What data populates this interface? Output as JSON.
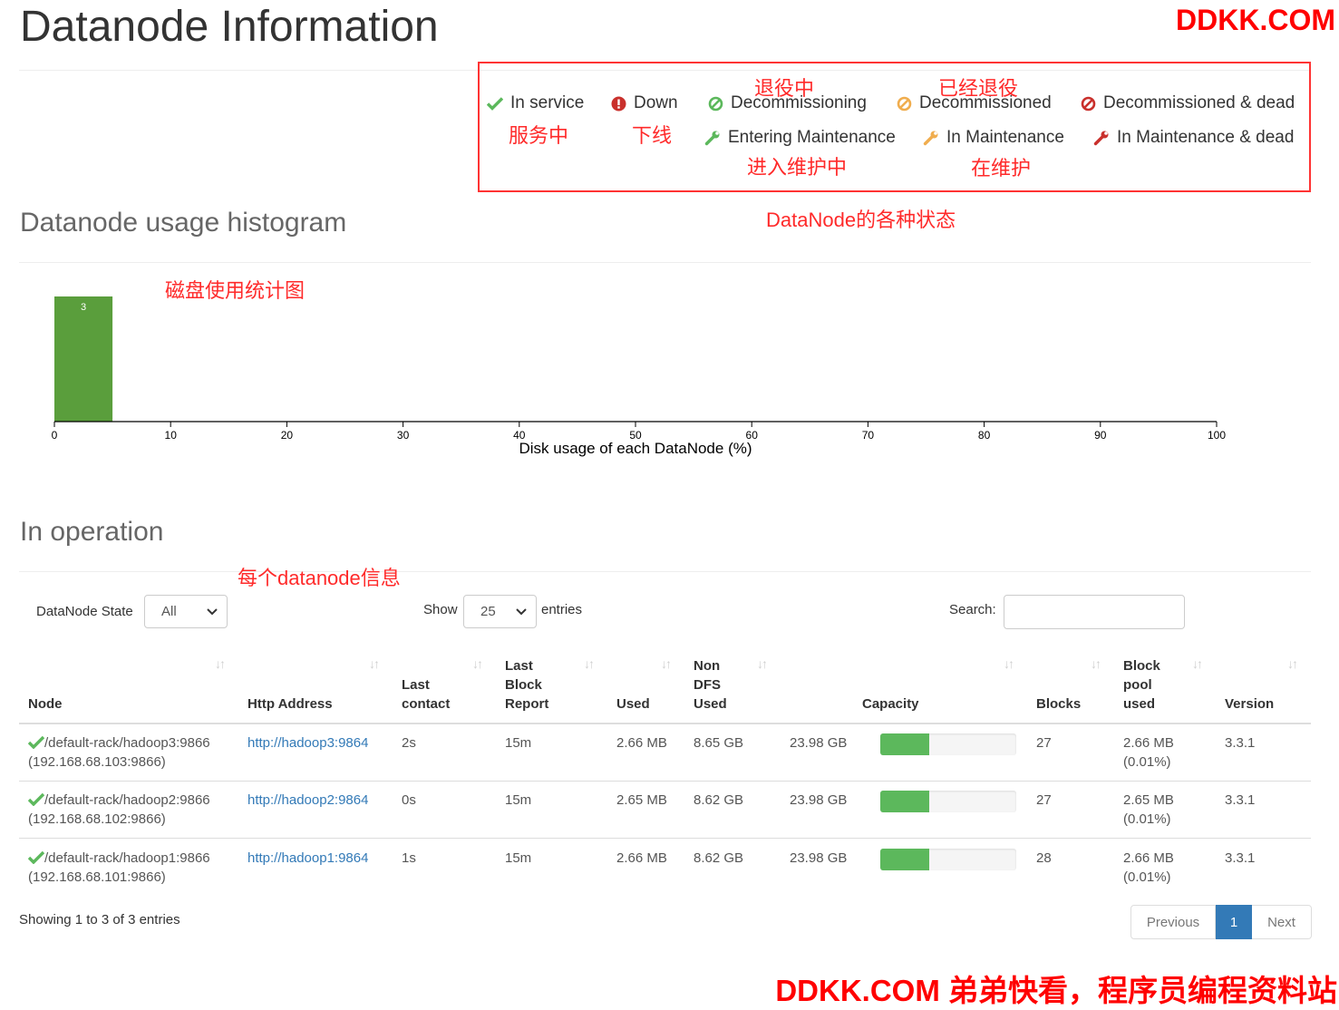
{
  "page": {
    "title": "Datanode Information",
    "watermark_top": "DDKK.COM",
    "watermark_bottom": "DDKK.COM 弟弟快看，程序员编程资料站"
  },
  "legend": {
    "items": [
      {
        "label": "In service",
        "icon": "check-icon",
        "color": "#5cb85c"
      },
      {
        "label": "Down",
        "icon": "exclamation-circle-icon",
        "color": "#d9534f"
      },
      {
        "label": "Decommissioning",
        "icon": "ban-icon",
        "color": "#5cb85c"
      },
      {
        "label": "Decommissioned",
        "icon": "ban-icon",
        "color": "#f0ad4e"
      },
      {
        "label": "Decommissioned & dead",
        "icon": "ban-icon",
        "color": "#d9534f"
      },
      {
        "label": "Entering Maintenance",
        "icon": "wrench-icon",
        "color": "#5cb85c"
      },
      {
        "label": "In Maintenance",
        "icon": "wrench-icon",
        "color": "#f0ad4e"
      },
      {
        "label": "In Maintenance & dead",
        "icon": "wrench-icon",
        "color": "#d9534f"
      }
    ]
  },
  "annotations": {
    "in_service": "服务中",
    "down": "下线",
    "decommissioning": "退役中",
    "decommissioned": "已经退役",
    "entering_maintenance": "进入维护中",
    "in_maintenance": "在维护",
    "states": "DataNode的各种状态",
    "histogram": "磁盘使用统计图",
    "datanode_info": "每个datanode信息"
  },
  "histogram": {
    "title": "Datanode usage histogram"
  },
  "chart_data": {
    "type": "bar",
    "x": [
      0,
      5
    ],
    "values": [
      3
    ],
    "data_labels": [
      "3"
    ],
    "xlabel": "Disk usage of each DataNode (%)",
    "xlim": [
      0,
      100
    ],
    "xticks": [
      "0",
      "10",
      "20",
      "30",
      "40",
      "50",
      "60",
      "70",
      "80",
      "90",
      "100"
    ],
    "bar_color": "#5a9e3c"
  },
  "operation": {
    "title": "In operation",
    "state_label": "DataNode State",
    "state_value": "All",
    "show_label": "Show",
    "entries_value": "25",
    "entries_label": "entries",
    "search_label": "Search:",
    "search_value": "",
    "columns": [
      {
        "label": "Node"
      },
      {
        "label": "Http Address"
      },
      {
        "label": "Last contact"
      },
      {
        "label": "Last Block Report"
      },
      {
        "label": "Used"
      },
      {
        "label": "Non DFS Used"
      },
      {
        "label": "Capacity"
      },
      {
        "label": "Blocks"
      },
      {
        "label": "Block pool used"
      },
      {
        "label": "Version"
      }
    ],
    "rows": [
      {
        "node": "/default-rack/hadoop3:9866",
        "node_ip": "(192.168.68.103:9866)",
        "http": "http://hadoop3:9864",
        "last_contact": "2s",
        "last_block_report": "15m",
        "used": "2.66 MB",
        "non_dfs": "8.65 GB",
        "capacity": "23.98 GB",
        "usage_fraction": 0.36,
        "blocks": "27",
        "bp_used": "2.66 MB",
        "bp_pct": "(0.01%)",
        "version": "3.3.1"
      },
      {
        "node": "/default-rack/hadoop2:9866",
        "node_ip": "(192.168.68.102:9866)",
        "http": "http://hadoop2:9864",
        "last_contact": "0s",
        "last_block_report": "15m",
        "used": "2.65 MB",
        "non_dfs": "8.62 GB",
        "capacity": "23.98 GB",
        "usage_fraction": 0.36,
        "blocks": "27",
        "bp_used": "2.65 MB",
        "bp_pct": "(0.01%)",
        "version": "3.3.1"
      },
      {
        "node": "/default-rack/hadoop1:9866",
        "node_ip": "(192.168.68.101:9866)",
        "http": "http://hadoop1:9864",
        "last_contact": "1s",
        "last_block_report": "15m",
        "used": "2.66 MB",
        "non_dfs": "8.62 GB",
        "capacity": "23.98 GB",
        "usage_fraction": 0.36,
        "blocks": "28",
        "bp_used": "2.66 MB",
        "bp_pct": "(0.01%)",
        "version": "3.3.1"
      }
    ],
    "footer_info": "Showing 1 to 3 of 3 entries",
    "pagination": {
      "previous": "Previous",
      "current": "1",
      "next": "Next"
    }
  }
}
